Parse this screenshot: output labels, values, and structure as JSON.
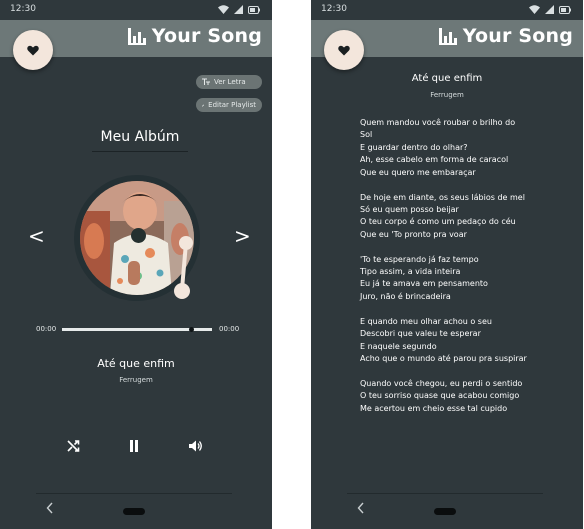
{
  "status_bar": {
    "time": "12:30"
  },
  "app": {
    "title": "Your Song"
  },
  "player": {
    "ver_letra_label": "Ver Letra",
    "editar_playlist_label": "Editar Playlist",
    "album_title": "Meu Albúm",
    "time_current": "00:00",
    "time_total": "00:00",
    "progress": 0.86,
    "song_title": "Até que enfim",
    "artist": "Ferrugem",
    "prev_glyph": "<",
    "next_glyph": ">"
  },
  "lyrics_screen": {
    "song_title": "Até que enfim",
    "artist": "Ferrugem",
    "stanzas": [
      [
        "Quem mandou você roubar o brilho do",
        "Sol",
        "E guardar dentro do olhar?",
        "Ah, esse cabelo em forma de caracol",
        "Que eu quero me embaraçar"
      ],
      [
        "De hoje em diante, os seus lábios de mel",
        "Só eu quem posso beijar",
        "O teu corpo é como um pedaço do céu",
        "Que eu 'To pronto pra voar"
      ],
      [
        "'To te esperando já faz tempo",
        "Tipo assim, a vida inteira",
        "Eu já te amava em pensamento",
        "Juro, não é brincadeira"
      ],
      [
        "E quando meu olhar achou o seu",
        "Descobri que valeu te esperar",
        "E naquele segundo",
        "Acho que o mundo até parou pra suspirar"
      ],
      [
        "Quando você chegou, eu perdi o sentido",
        "O teu sorriso quase que acabou comigo",
        "Me acertou em cheio esse tal cupido"
      ]
    ]
  },
  "icons": [
    "wifi-icon",
    "signal-icon",
    "battery-icon",
    "equalizer-logo-icon",
    "heart-icon",
    "lyrics-icon",
    "edit-icon",
    "shuffle-icon",
    "pause-icon",
    "volume-icon",
    "back-nav-icon"
  ],
  "colors": {
    "background": "#2f383c",
    "appbar": "#6d7878",
    "fav_button": "#f3e6dc",
    "disc": "#243034",
    "tonearm": "#f3e6dc"
  }
}
